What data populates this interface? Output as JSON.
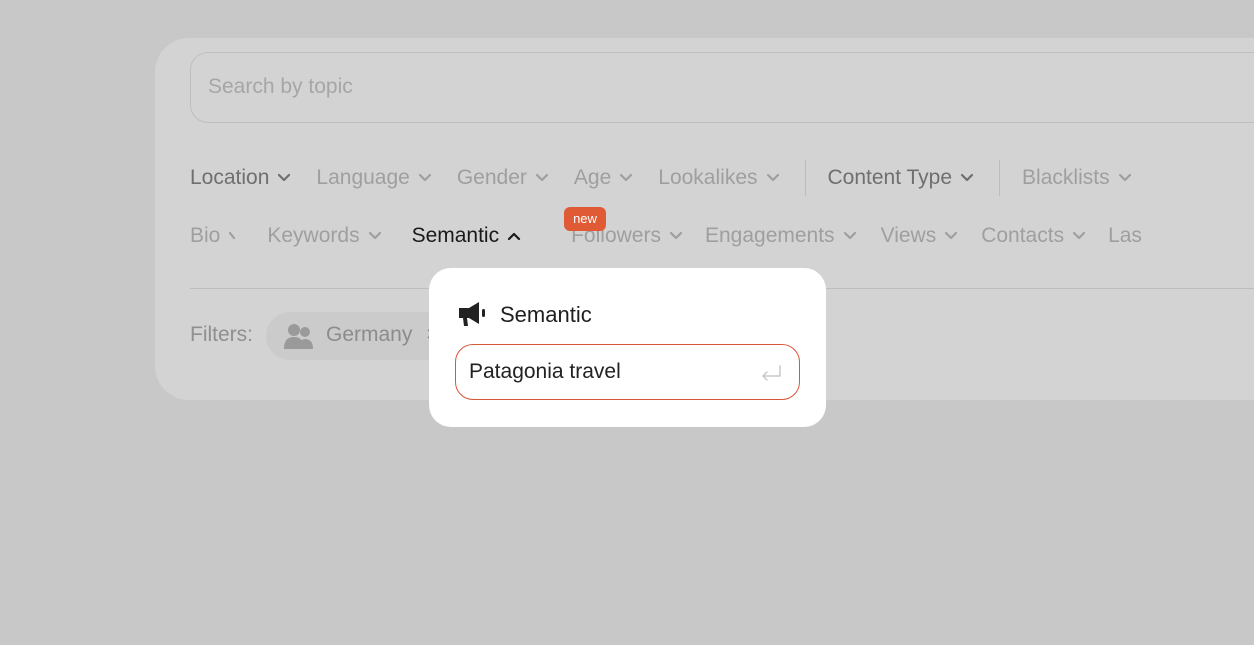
{
  "search": {
    "placeholder": "Search by topic"
  },
  "filters_row1": [
    {
      "label": "Location"
    },
    {
      "label": "Language"
    },
    {
      "label": "Gender"
    },
    {
      "label": "Age"
    },
    {
      "label": "Lookalikes"
    },
    {
      "label": "Content Type"
    },
    {
      "label": "Blacklists"
    }
  ],
  "filters_row2": [
    {
      "label": "Bio"
    },
    {
      "label": "Keywords"
    },
    {
      "label": "Semantic"
    },
    {
      "label": "Followers"
    },
    {
      "label": "Engagements"
    },
    {
      "label": "Views"
    },
    {
      "label": "Contacts"
    },
    {
      "label": "Las"
    }
  ],
  "semantic_badge": "new",
  "active_filters": {
    "label": "Filters:",
    "chip": "Germany",
    "chip_close": "×"
  },
  "popup": {
    "title": "Semantic",
    "input_value": "Patagonia travel"
  },
  "colors": {
    "accent": "#e05a35",
    "overlay": "#c8c8c8",
    "popup_bg": "#ffffff"
  },
  "icons": {
    "popup_icon": "megaphone-icon",
    "chip_icon": "users-icon",
    "input_icon": "enter-icon"
  }
}
